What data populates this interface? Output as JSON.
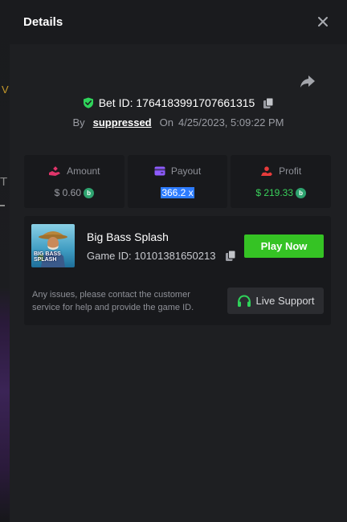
{
  "modal": {
    "title": "Details"
  },
  "bet": {
    "id_label": "Bet ID: 1764183991707661315",
    "by_label": "By",
    "username": "suppressed",
    "on_label": "On",
    "datetime": "4/25/2023, 5:09:22 PM"
  },
  "stats": [
    {
      "label": "Amount",
      "value": "$ 0.60",
      "color": "#9a9ca3",
      "coin": true,
      "highlight": false
    },
    {
      "label": "Payout",
      "value": "366.2 x",
      "color": "#ffffff",
      "coin": false,
      "highlight": true
    },
    {
      "label": "Profit",
      "value": "$ 219.33",
      "color": "#3ad15b",
      "coin": true,
      "highlight": false
    }
  ],
  "game": {
    "name": "Big Bass Splash",
    "id_label": "Game ID: 10101381650213",
    "thumb_text_1": "BIG BASS",
    "thumb_text_2": "SPLASH",
    "play_label": "Play Now"
  },
  "support": {
    "notice": "Any issues, please contact the customer service for help and provide the game ID.",
    "button_label": "Live Support"
  },
  "coin_letter": "b",
  "icons": {
    "close": "close-icon",
    "share": "share-icon",
    "verified": "shield-check-icon",
    "copy": "copy-icon",
    "amount": "hand-coin-icon",
    "payout": "wallet-icon",
    "profit": "profit-icon",
    "support": "headset-icon"
  },
  "colors": {
    "accent_green": "#35c324",
    "profit_green": "#3ad15b",
    "amount_icon": "#e0356a",
    "payout_icon": "#8e5bff",
    "profit_icon": "#e83b3b",
    "coin": "#2ea36f"
  }
}
